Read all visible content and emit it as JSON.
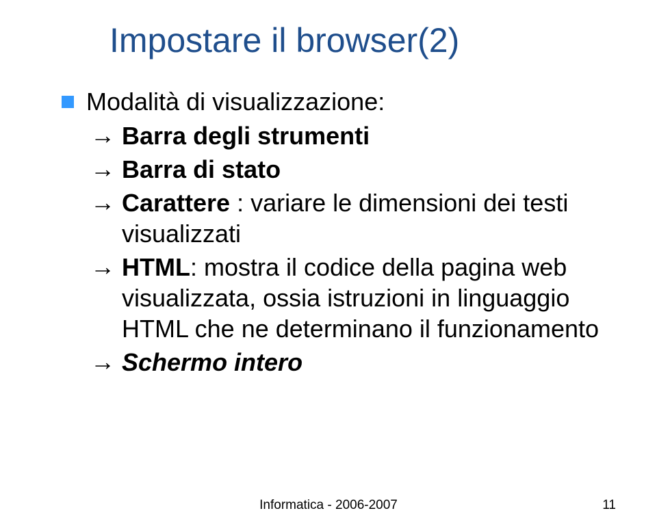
{
  "title": "Impostare il browser(2)",
  "bullet1": "Modalità di visualizzazione:",
  "items": {
    "i1": {
      "bold": "Barra degli strumenti",
      "rest": ""
    },
    "i2": {
      "bold": "Barra di stato",
      "rest": ""
    },
    "i3": {
      "bold": "Carattere",
      "rest": " : variare le dimensioni dei testi visualizzati"
    },
    "i4": {
      "bold": "HTML",
      "rest": ": mostra il codice della pagina web visualizzata, ossia istruzioni in linguaggio HTML che ne determinano il funzionamento"
    },
    "i5": {
      "bold": "Schermo intero",
      "rest": ""
    }
  },
  "footer": {
    "center": "Informatica - 2006-2007",
    "page": "11"
  }
}
